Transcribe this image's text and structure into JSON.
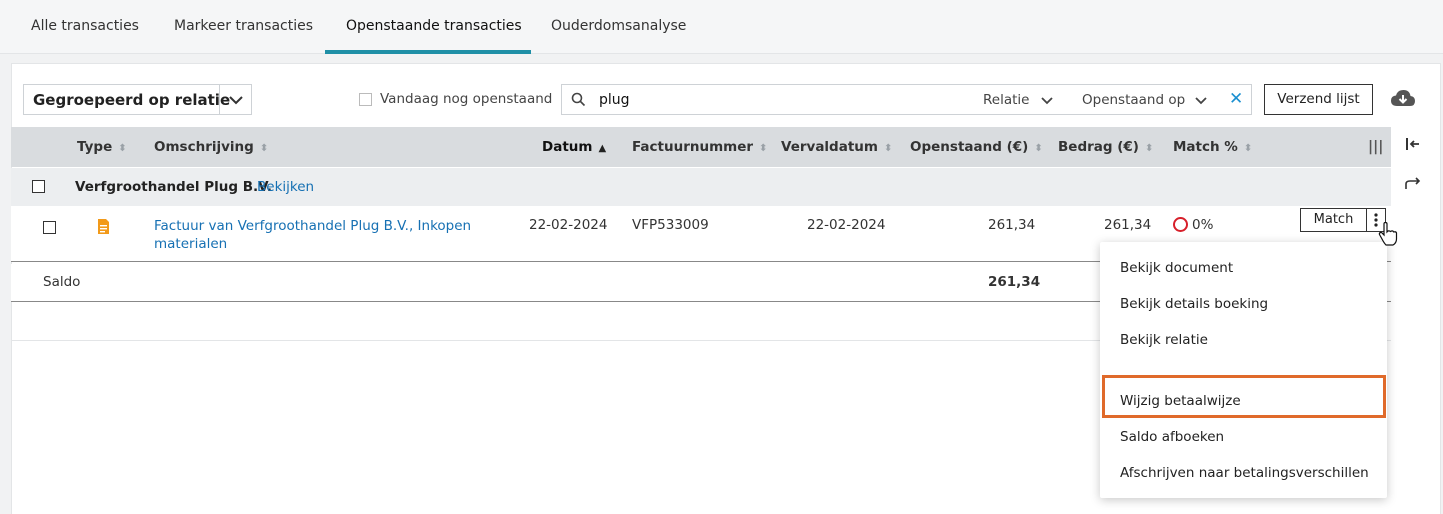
{
  "tabs": [
    {
      "label": "Alle transacties"
    },
    {
      "label": "Markeer transacties"
    },
    {
      "label": "Openstaande transacties"
    },
    {
      "label": "Ouderdomsanalyse"
    }
  ],
  "toolbar": {
    "group_select": "Gegroepeerd op relatie",
    "today_open_label": "Vandaag nog openstaand",
    "search_value": "plug",
    "filter_relation": "Relatie",
    "filter_open_on": "Openstaand op",
    "send_list": "Verzend lijst"
  },
  "table": {
    "headers": [
      "Type",
      "Omschrijving",
      "Datum",
      "Factuurnummer",
      "Vervaldatum",
      "Openstaand (€)",
      "Bedrag (€)",
      "Match %"
    ],
    "group": {
      "name": "Verfgroothandel Plug B.V.",
      "link": "Bekijken"
    },
    "row": {
      "description": "Factuur van  Verfgroothandel Plug B.V., Inkopen materialen",
      "date": "22-02-2024",
      "invoice": "VFP533009",
      "due": "22-02-2024",
      "open": "261,34",
      "amount": "261,34",
      "match_pct": "0%",
      "match_button": "Match"
    },
    "saldo": {
      "label": "Saldo",
      "open": "261,34"
    }
  },
  "context_menu": {
    "items": [
      "Bekijk document",
      "Bekijk details boeking",
      "Bekijk relatie",
      "Wijzig betaalwijze",
      "Saldo afboeken",
      "Afschrijven naar betalingsverschillen"
    ],
    "highlighted": "Wijzig betaalwijze"
  },
  "colors": {
    "accent": "#1f8fa6",
    "link": "#1670b3",
    "highlight": "#e06a2a",
    "match_zero": "#d71f2a"
  }
}
